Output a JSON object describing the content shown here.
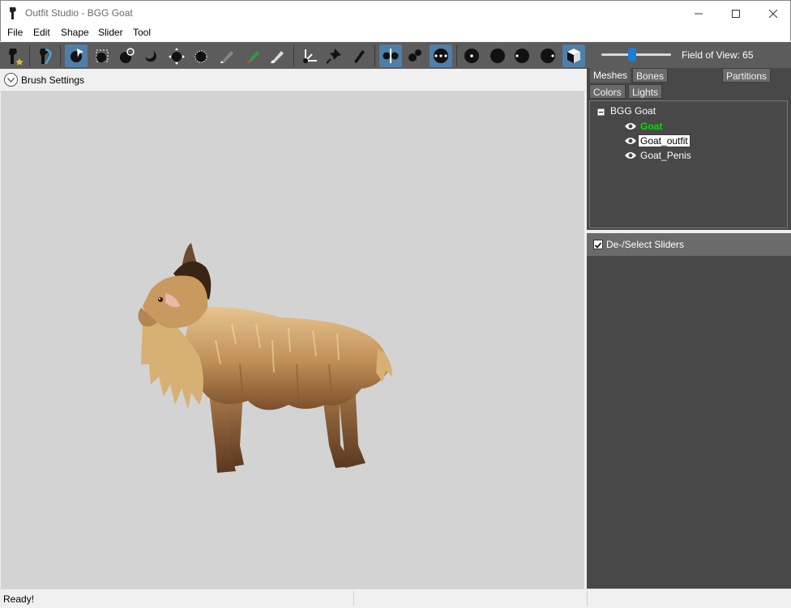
{
  "window": {
    "title": "Outfit Studio - BGG Goat"
  },
  "menu": [
    "File",
    "Edit",
    "Shape",
    "Slider",
    "Tool"
  ],
  "toolbar": {
    "buttons": [
      "new-project-icon",
      "load-reference-icon",
      "select-brush-icon",
      "mask-brush-icon",
      "inflate-brush-icon",
      "deflate-brush-icon",
      "move-brush-icon",
      "smooth-brush-icon",
      "undiff-brush-icon",
      "color-brush-icon",
      "alpha-brush-icon",
      "transform-icon",
      "pivot-icon",
      "collision-brush-icon",
      "x-mirror-icon",
      "connected-only-icon",
      "global-brush-icon",
      "vertex-view-icon",
      "wireframe-icon",
      "lighting-icon",
      "texture-icon",
      "mask-view-icon"
    ]
  },
  "camera": {
    "fov_label": "Field of View: 65",
    "fov_value": 65
  },
  "brush_settings": {
    "label": "Brush Settings"
  },
  "tabs": {
    "meshes": "Meshes",
    "bones": "Bones",
    "partitions": "Partitions",
    "colors": "Colors",
    "lights": "Lights"
  },
  "tree": {
    "root": "BGG Goat",
    "items": [
      {
        "label": "Goat",
        "state": "active",
        "visible_icon": "eye-icon"
      },
      {
        "label": "Goat_outfit",
        "state": "selected",
        "visible_icon": "eye-icon"
      },
      {
        "label": "Goat_Penis",
        "state": "normal",
        "visible_icon": "eye-icon"
      }
    ]
  },
  "sliders": {
    "label": "De-/Select Sliders",
    "checked": true
  },
  "status": {
    "text": "Ready!"
  },
  "colors": {
    "toolbar_bg": "#5c5c5c",
    "active_tool": "#4f7fa8",
    "viewport_bg": "#d3d3d3",
    "panel_bg": "#484848",
    "active_mesh": "#00e000"
  }
}
